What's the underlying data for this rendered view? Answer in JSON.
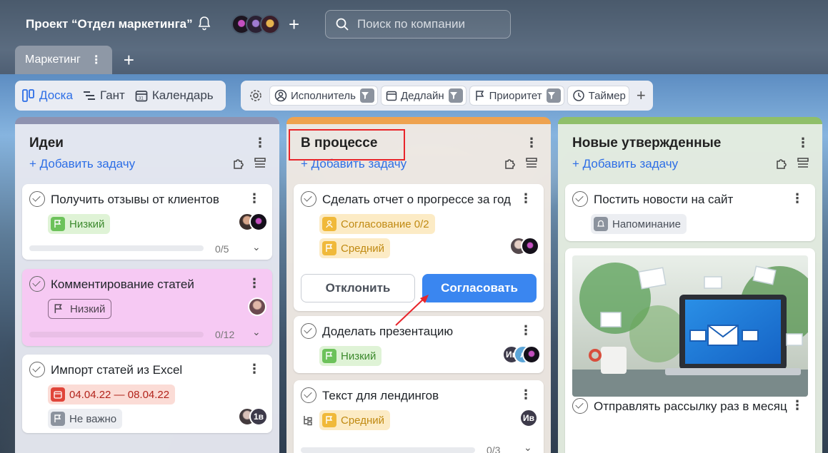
{
  "header": {
    "project_title": "Проект “Отдел маркетинга”",
    "search_placeholder": "Поиск по компании",
    "tabs": [
      {
        "label": "Маркетинг"
      }
    ]
  },
  "views": [
    {
      "label": "Доска",
      "active": true
    },
    {
      "label": "Гант",
      "active": false
    },
    {
      "label": "Календарь",
      "active": false
    }
  ],
  "filters": [
    {
      "label": "Исполнитель",
      "icon": "user-icon"
    },
    {
      "label": "Дедлайн",
      "icon": "calendar-icon"
    },
    {
      "label": "Приоритет",
      "icon": "flag-icon"
    },
    {
      "label": "Таймер",
      "icon": "timer-icon"
    }
  ],
  "colors": {
    "accent": "#2d6ee6",
    "col1_bar": "#8e92b0",
    "col2_bar": "#eea24f",
    "col3_bar": "#8fbf6a"
  },
  "columns": [
    {
      "title": "Идеи",
      "add_task": "Добавить задачу",
      "cards": [
        {
          "title": "Получить отзывы от клиентов",
          "tag": "Низкий",
          "progress": "0/5"
        },
        {
          "title": "Комментирование статей",
          "tag": "Низкий",
          "progress": "0/12"
        },
        {
          "title": "Импорт статей из Excel",
          "date": "04.04.22 — 08.04.22",
          "tag": "Не важно",
          "avatar": "1в"
        }
      ]
    },
    {
      "title": "В процессе",
      "add_task": "Добавить задачу",
      "cards": [
        {
          "title": "Сделать отчет о прогрессе за год",
          "approval": "Согласование 0/2",
          "tag": "Средний",
          "reject": "Отклонить",
          "approve": "Согласовать"
        },
        {
          "title": "Доделать презентацию",
          "tag": "Низкий",
          "avatar1": "Ив",
          "avatar2": "л"
        },
        {
          "title": "Текст для лендингов",
          "tag": "Средний",
          "avatar": "Ив",
          "progress": "0/3"
        }
      ]
    },
    {
      "title": "Новые утвержденные",
      "add_task": "Добавить задачу",
      "cards": [
        {
          "title": "Постить новости на сайт",
          "tag": "Напоминание"
        },
        {
          "title": "Отправлять рассылку раз в месяц"
        }
      ]
    }
  ]
}
